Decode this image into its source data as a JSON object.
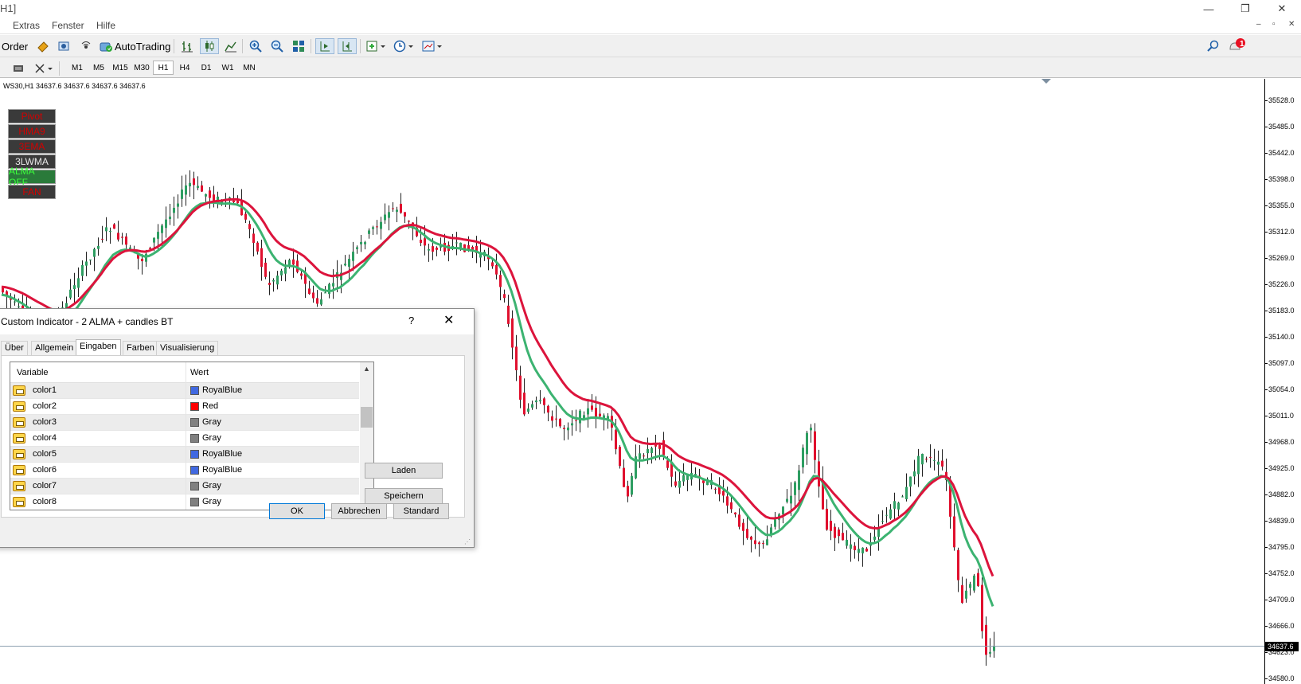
{
  "window": {
    "title": "H1]",
    "controls": [
      "—",
      "❐",
      "✕"
    ]
  },
  "menu": [
    "Extras",
    "Fenster",
    "Hilfe"
  ],
  "mdi_controls": [
    "–",
    "▫",
    "✕"
  ],
  "toolbar": {
    "order_label": "Order",
    "autotrading_label": "AutoTrading",
    "notification_count": "1"
  },
  "timeframes": [
    "M1",
    "M5",
    "M15",
    "M30",
    "H1",
    "H4",
    "D1",
    "W1",
    "MN"
  ],
  "active_timeframe": "H1",
  "chart": {
    "header": "WS30,H1  34637.6 34637.6 34637.6 34637.6",
    "current_price": "34637.6",
    "price_labels": [
      "35528.0",
      "35485.0",
      "35442.0",
      "35398.0",
      "35355.0",
      "35312.0",
      "35269.0",
      "35226.0",
      "35183.0",
      "35140.0",
      "35097.0",
      "35054.0",
      "35011.0",
      "34968.0",
      "34925.0",
      "34882.0",
      "34839.0",
      "34795.0",
      "34752.0",
      "34709.0",
      "34666.0",
      "34623.0",
      "34580.0"
    ],
    "indicator_buttons": [
      {
        "label": "Pivot",
        "color": "red"
      },
      {
        "label": "HMA9",
        "color": "red"
      },
      {
        "label": "3EMA",
        "color": "red"
      },
      {
        "label": "3LWMA",
        "color": "white"
      },
      {
        "label": "ALMA OFF",
        "color": "green"
      },
      {
        "label": "FAN",
        "color": "red"
      }
    ],
    "colors": {
      "bull": "#2e9e62",
      "bear": "#e0102e",
      "fast_line": "#3cb371",
      "slow_line": "#dc143c"
    }
  },
  "dialog": {
    "title": "Custom Indicator - 2 ALMA + candles BT",
    "help": "?",
    "close": "✕",
    "tabs": [
      "Über",
      "Allgemein",
      "Eingaben",
      "Farben",
      "Visualisierung"
    ],
    "active_tab": "Eingaben",
    "columns": {
      "variable": "Variable",
      "value": "Wert"
    },
    "rows": [
      {
        "variable": "color1",
        "value": "RoyalBlue",
        "swatch": "#4169e1"
      },
      {
        "variable": "color2",
        "value": "Red",
        "swatch": "#ff0000"
      },
      {
        "variable": "color3",
        "value": "Gray",
        "swatch": "#808080"
      },
      {
        "variable": "color4",
        "value": "Gray",
        "swatch": "#808080"
      },
      {
        "variable": "color5",
        "value": "RoyalBlue",
        "swatch": "#4169e1"
      },
      {
        "variable": "color6",
        "value": "RoyalBlue",
        "swatch": "#4169e1"
      },
      {
        "variable": "color7",
        "value": "Gray",
        "swatch": "#808080"
      },
      {
        "variable": "color8",
        "value": "Gray",
        "swatch": "#808080"
      }
    ],
    "load_label": "Laden",
    "save_label": "Speichern",
    "ok_label": "OK",
    "cancel_label": "Abbrechen",
    "default_label": "Standard"
  }
}
